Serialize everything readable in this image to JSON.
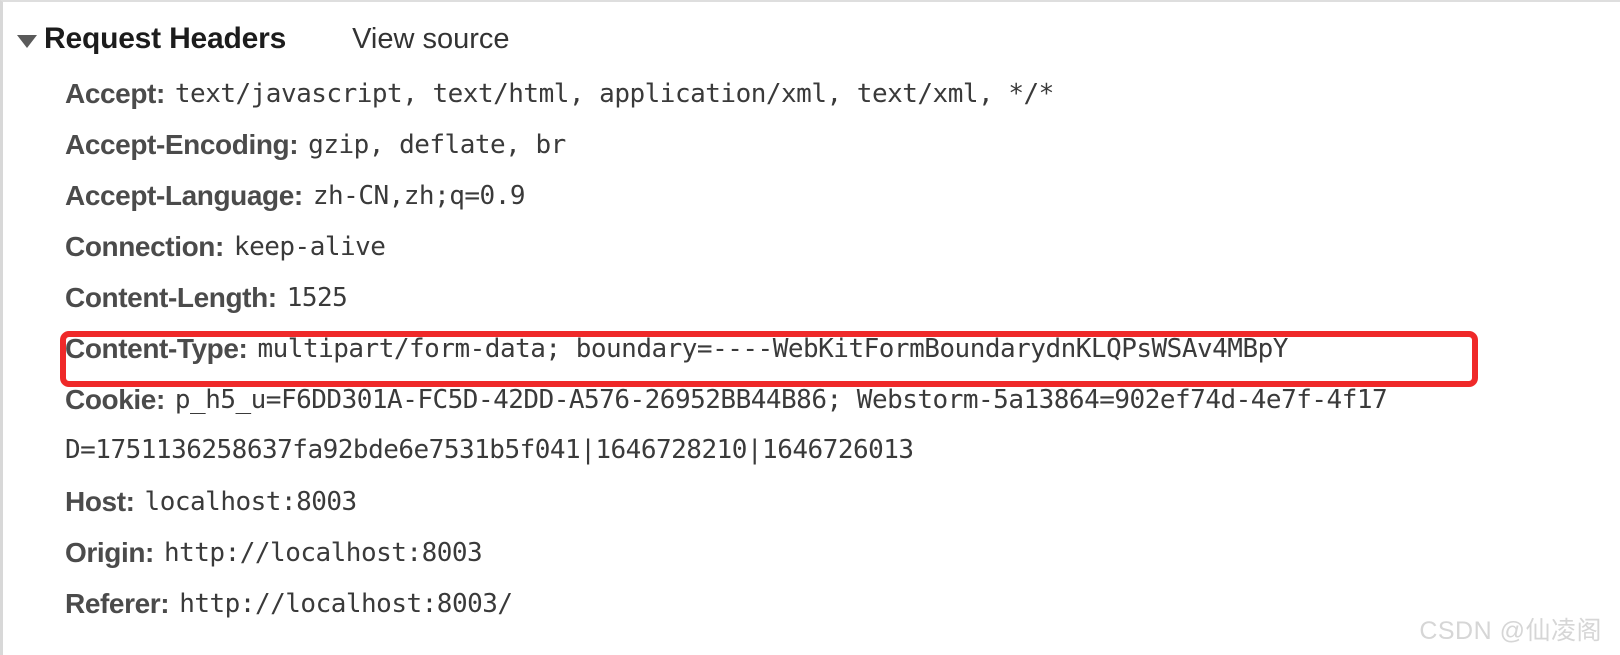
{
  "panel": {
    "section_title": "Request Headers",
    "view_source_label": "View source",
    "disclosure_state": "expanded",
    "accent_highlight_color": "#ef2929",
    "name_color": "#4b4b4b",
    "value_color": "#3a3a3a"
  },
  "headers": [
    {
      "name": "Accept:",
      "value": "text/javascript, text/html, application/xml, text/xml, */*",
      "highlighted": false
    },
    {
      "name": "Accept-Encoding:",
      "value": "gzip, deflate, br",
      "highlighted": false
    },
    {
      "name": "Accept-Language:",
      "value": "zh-CN,zh;q=0.9",
      "highlighted": false
    },
    {
      "name": "Connection:",
      "value": "keep-alive",
      "highlighted": false
    },
    {
      "name": "Content-Length:",
      "value": "1525",
      "highlighted": false
    },
    {
      "name": "Content-Type:",
      "value": "multipart/form-data; boundary=----WebKitFormBoundarydnKLQPsWSAv4MBpY",
      "highlighted": true
    },
    {
      "name": "Cookie:",
      "value": "p_h5_u=F6DD301A-FC5D-42DD-A576-26952BB44B86; Webstorm-5a13864=902ef74d-4e7f-4f17",
      "value_line2": "D=1751136258637fa92bde6e7531b5f041|1646728210|1646726013",
      "highlighted": false
    },
    {
      "name": "Host:",
      "value": "localhost:8003",
      "highlighted": false
    },
    {
      "name": "Origin:",
      "value": "http://localhost:8003",
      "highlighted": false
    },
    {
      "name": "Referer:",
      "value": "http://localhost:8003/",
      "highlighted": false
    }
  ],
  "watermark": {
    "text": "CSDN @仙凌阁"
  }
}
